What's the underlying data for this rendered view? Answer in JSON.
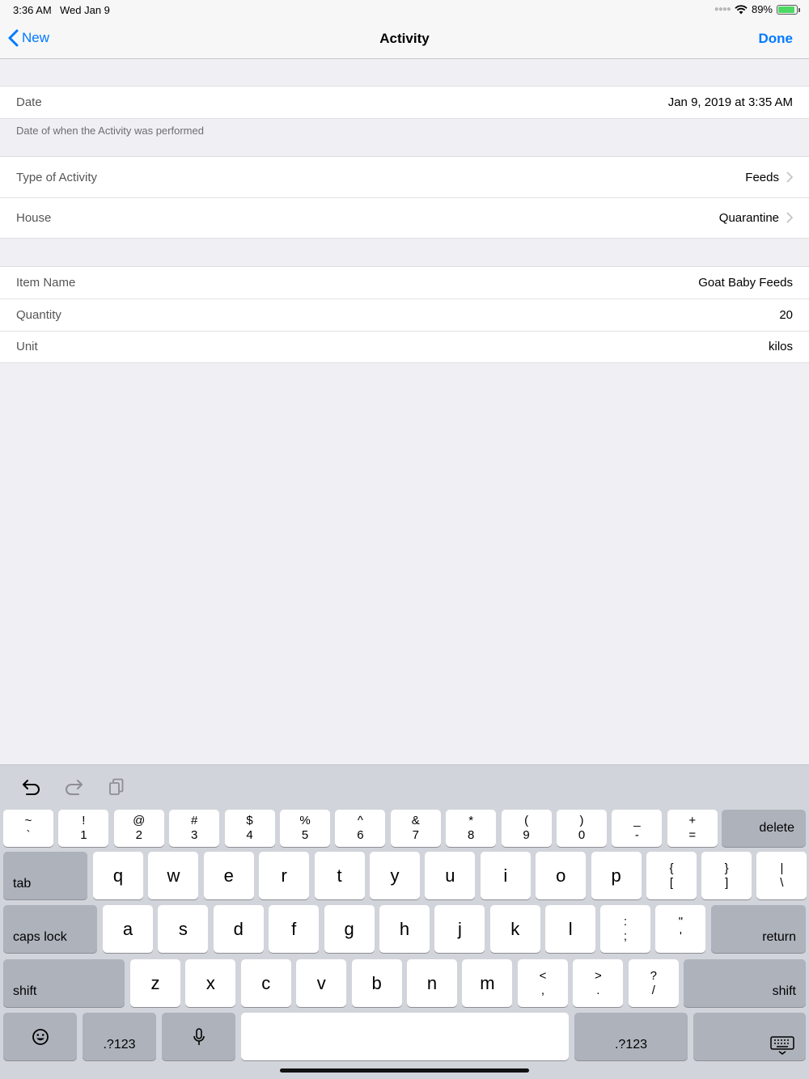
{
  "status_bar": {
    "time": "3:36 AM",
    "date": "Wed Jan 9",
    "battery_percent": "89%",
    "battery_level": 0.89
  },
  "nav": {
    "back_label": "New",
    "title": "Activity",
    "done_label": "Done"
  },
  "form": {
    "date": {
      "label": "Date",
      "value": "Jan 9, 2019 at 3:35 AM",
      "footer": "Date of when the Activity was performed"
    },
    "type_of_activity": {
      "label": "Type of Activity",
      "value": "Feeds"
    },
    "house": {
      "label": "House",
      "value": "Quarantine"
    },
    "item_name": {
      "label": "Item Name",
      "value": "Goat Baby Feeds"
    },
    "quantity": {
      "label": "Quantity",
      "value": "20"
    },
    "unit": {
      "label": "Unit",
      "value": "kilos"
    }
  },
  "keyboard": {
    "toolbar_icons": [
      "undo-icon",
      "redo-icon",
      "paste-icon"
    ],
    "row1": [
      {
        "top": "~",
        "bot": "`"
      },
      {
        "top": "!",
        "bot": "1"
      },
      {
        "top": "@",
        "bot": "2"
      },
      {
        "top": "#",
        "bot": "3"
      },
      {
        "top": "$",
        "bot": "4"
      },
      {
        "top": "%",
        "bot": "5"
      },
      {
        "top": "^",
        "bot": "6"
      },
      {
        "top": "&",
        "bot": "7"
      },
      {
        "top": "*",
        "bot": "8"
      },
      {
        "top": "(",
        "bot": "9"
      },
      {
        "top": ")",
        "bot": "0"
      },
      {
        "top": "_",
        "bot": "-"
      },
      {
        "top": "+",
        "bot": "="
      }
    ],
    "delete_label": "delete",
    "tab_label": "tab",
    "row2": [
      "q",
      "w",
      "e",
      "r",
      "t",
      "y",
      "u",
      "i",
      "o",
      "p"
    ],
    "row2_dual": [
      {
        "top": "{",
        "bot": "["
      },
      {
        "top": "}",
        "bot": "]"
      },
      {
        "top": "|",
        "bot": "\\"
      }
    ],
    "caps_lock_label": "caps lock",
    "row3": [
      "a",
      "s",
      "d",
      "f",
      "g",
      "h",
      "j",
      "k",
      "l"
    ],
    "row3_dual": [
      {
        "top": ":",
        "bot": ";"
      },
      {
        "top": "\"",
        "bot": "'"
      }
    ],
    "return_label": "return",
    "shift_label": "shift",
    "row4": [
      "z",
      "x",
      "c",
      "v",
      "b",
      "n",
      "m"
    ],
    "row4_dual": [
      {
        "top": "<",
        "bot": ","
      },
      {
        "top": ">",
        "bot": "."
      },
      {
        "top": "?",
        "bot": "/"
      }
    ],
    "numbers_label": ".?123",
    "bottom_icons": [
      "emoji-icon",
      "microphone-icon",
      "dismiss-keyboard-icon"
    ]
  }
}
